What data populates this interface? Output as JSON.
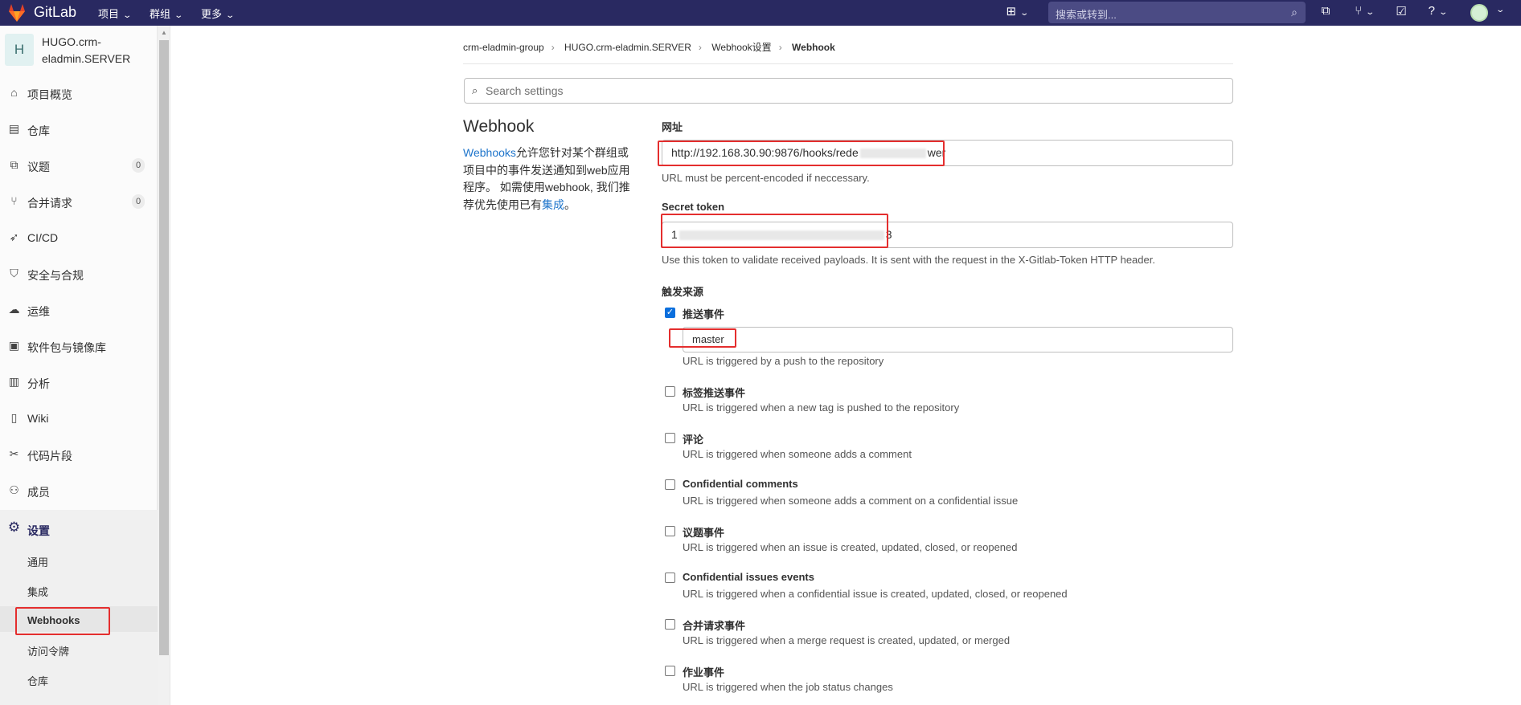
{
  "topbar": {
    "brand": "GitLab",
    "nav": [
      {
        "label": "项目"
      },
      {
        "label": "群组"
      },
      {
        "label": "更多"
      }
    ],
    "search_placeholder": "搜索或转到..."
  },
  "project": {
    "avatar_letter": "H",
    "name": "HUGO.crm-eladmin.SERVER"
  },
  "sidebar": {
    "items": [
      {
        "label": "项目概览",
        "icon": "home-icon"
      },
      {
        "label": "仓库",
        "icon": "file-icon"
      },
      {
        "label": "议题",
        "icon": "issues-icon",
        "count": "0"
      },
      {
        "label": "合并请求",
        "icon": "merge-request-icon",
        "count": "0"
      },
      {
        "label": "CI/CD",
        "icon": "rocket-icon"
      },
      {
        "label": "安全与合规",
        "icon": "shield-icon"
      },
      {
        "label": "运维",
        "icon": "cloud-gear-icon"
      },
      {
        "label": "软件包与镜像库",
        "icon": "package-icon"
      },
      {
        "label": "分析",
        "icon": "chart-icon"
      },
      {
        "label": "Wiki",
        "icon": "book-icon"
      },
      {
        "label": "代码片段",
        "icon": "scissors-icon"
      },
      {
        "label": "成员",
        "icon": "users-icon"
      }
    ],
    "settings": {
      "label": "设置",
      "icon": "gear-icon",
      "subitems": [
        "通用",
        "集成",
        "Webhooks",
        "访问令牌",
        "仓库"
      ]
    }
  },
  "breadcrumb": [
    "crm-eladmin-group",
    "HUGO.crm-eladmin.SERVER",
    "Webhook设置",
    "Webhook"
  ],
  "settings_search_placeholder": "Search settings",
  "webhook": {
    "title": "Webhook",
    "desc_link": "Webhooks",
    "desc_text": "允许您针对某个群组或项目中的事件发送通知到web应用程序。 如需使用webhook, 我们推荐优先使用已有",
    "desc_link2": "集成",
    "desc_end": "。"
  },
  "form": {
    "url_label": "网址",
    "url_value_a": "http://192.168.30.90:9876/hooks/rede",
    "url_value_b": "wer",
    "url_help": "URL must be percent-encoded if neccessary.",
    "token_label": "Secret token",
    "token_value_a": "1",
    "token_value_b": "3",
    "token_help": "Use this token to validate received payloads. It is sent with the request in the X-Gitlab-Token HTTP header.",
    "trigger_label": "触发来源",
    "push_branch": "master",
    "triggers": [
      {
        "label": "推送事件",
        "help": "URL is triggered by a push to the repository",
        "checked": true
      },
      {
        "label": "标签推送事件",
        "help": "URL is triggered when a new tag is pushed to the repository",
        "checked": false
      },
      {
        "label": "评论",
        "help": "URL is triggered when someone adds a comment",
        "checked": false
      },
      {
        "label": "Confidential comments",
        "help": "URL is triggered when someone adds a comment on a confidential issue",
        "checked": false
      },
      {
        "label": "议题事件",
        "help": "URL is triggered when an issue is created, updated, closed, or reopened",
        "checked": false
      },
      {
        "label": "Confidential issues events",
        "help": "URL is triggered when a confidential issue is created, updated, closed, or reopened",
        "checked": false
      },
      {
        "label": "合并请求事件",
        "help": "URL is triggered when a merge request is created, updated, or merged",
        "checked": false
      },
      {
        "label": "作业事件",
        "help": "URL is triggered when the job status changes",
        "checked": false
      }
    ]
  },
  "colors": {
    "topbar": "#292961",
    "highlight": "#e42e2e",
    "link": "#1f75cb",
    "checkbox": "#0b6fdd"
  }
}
